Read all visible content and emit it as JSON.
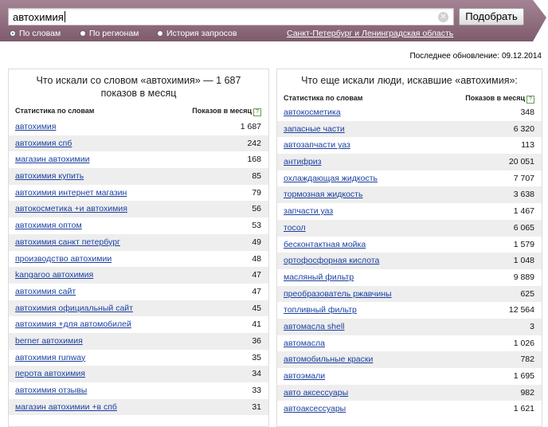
{
  "search": {
    "query": "автохимия",
    "submit_label": "Подобрать"
  },
  "modes": [
    {
      "label": "По словам",
      "selected": true
    },
    {
      "label": "По регионам",
      "selected": false
    },
    {
      "label": "История запросов",
      "selected": false
    }
  ],
  "region": "Санкт-Петербург и Ленинградская область",
  "updated": {
    "label": "Последнее обновление:",
    "date": "09.12.2014"
  },
  "colors": {
    "band": "#8a6677",
    "link": "#1a3fa0",
    "row_alt": "#eeeeee"
  },
  "left_panel": {
    "title": "Что искали со словом «автохимия» — 1 687 показов в месяц",
    "col_keyword": "Статистика по словам",
    "col_count": "Показов в месяц",
    "help": "?",
    "rows": [
      {
        "keyword": "автохимия",
        "count": "1 687"
      },
      {
        "keyword": "автохимия спб",
        "count": "242"
      },
      {
        "keyword": "магазин автохимии",
        "count": "168"
      },
      {
        "keyword": "автохимия купить",
        "count": "85"
      },
      {
        "keyword": "автохимия интернет магазин",
        "count": "79"
      },
      {
        "keyword": "автокосметика +и автохимия",
        "count": "56"
      },
      {
        "keyword": "автохимия оптом",
        "count": "53"
      },
      {
        "keyword": "автохимия санкт петербург",
        "count": "49"
      },
      {
        "keyword": "производство автохимии",
        "count": "48"
      },
      {
        "keyword": "kangaroo автохимия",
        "count": "47"
      },
      {
        "keyword": "автохимия сайт",
        "count": "47"
      },
      {
        "keyword": "автохимия официальный сайт",
        "count": "45"
      },
      {
        "keyword": "автохимия +для автомобилей",
        "count": "41"
      },
      {
        "keyword": "berner автохимия",
        "count": "36"
      },
      {
        "keyword": "автохимия runway",
        "count": "35"
      },
      {
        "keyword": "перота автохимия",
        "count": "34"
      },
      {
        "keyword": "автохимия отзывы",
        "count": "33"
      },
      {
        "keyword": "магазин автохимии +в спб",
        "count": "31"
      }
    ]
  },
  "right_panel": {
    "title": "Что еще искали люди, искавшие «автохимия»:",
    "col_keyword": "Статистика по словам",
    "col_count": "Показов в месяц",
    "help": "?",
    "rows": [
      {
        "keyword": "автокосметика",
        "count": "348"
      },
      {
        "keyword": "запасные части",
        "count": "6 320"
      },
      {
        "keyword": "автозапчасти уаз",
        "count": "113"
      },
      {
        "keyword": "антифриз",
        "count": "20 051"
      },
      {
        "keyword": "охлаждающая жидкость",
        "count": "7 707"
      },
      {
        "keyword": "тормозная жидкость",
        "count": "3 638"
      },
      {
        "keyword": "запчасти уаз",
        "count": "1 467"
      },
      {
        "keyword": "тосол",
        "count": "6 065"
      },
      {
        "keyword": "бесконтактная мойка",
        "count": "1 579"
      },
      {
        "keyword": "ортофосфорная кислота",
        "count": "1 048"
      },
      {
        "keyword": "масляный фильтр",
        "count": "9 889"
      },
      {
        "keyword": "преобразователь ржавчины",
        "count": "625"
      },
      {
        "keyword": "топливный фильтр",
        "count": "12 564"
      },
      {
        "keyword": "автомасла shell",
        "count": "3"
      },
      {
        "keyword": "автомасла",
        "count": "1 026"
      },
      {
        "keyword": "автомобильные краски",
        "count": "782"
      },
      {
        "keyword": "автоэмали",
        "count": "1 695"
      },
      {
        "keyword": "авто аксессуары",
        "count": "982"
      },
      {
        "keyword": "автоаксессуары",
        "count": "1 621"
      }
    ]
  }
}
